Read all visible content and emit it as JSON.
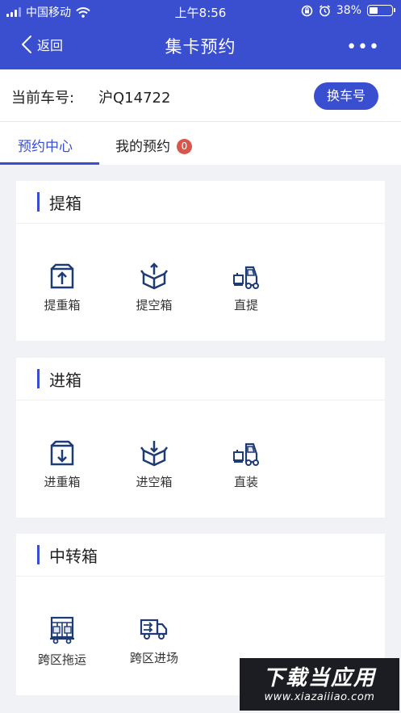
{
  "status_bar": {
    "carrier": "中国移动",
    "time": "上午8:56",
    "battery_percent": "38%",
    "battery_level": 0.38,
    "icons": [
      "signal-icon",
      "wifi-icon",
      "rotation-lock-icon",
      "alarm-icon",
      "battery-icon"
    ]
  },
  "header": {
    "back_label": "返回",
    "title": "集卡预约",
    "more_label": "•••"
  },
  "plate": {
    "label": "当前车号:",
    "value": "沪Q14722",
    "change_button": "换车号"
  },
  "tabs": [
    {
      "label": "预约中心",
      "active": true
    },
    {
      "label": "我的预约",
      "badge": "0",
      "active": false
    }
  ],
  "sections": [
    {
      "title": "提箱",
      "items": [
        {
          "label": "提重箱",
          "icon": "box-up-arrow-icon"
        },
        {
          "label": "提空箱",
          "icon": "open-box-up-arrow-icon"
        },
        {
          "label": "直提",
          "icon": "forklift-icon"
        }
      ]
    },
    {
      "title": "进箱",
      "items": [
        {
          "label": "进重箱",
          "icon": "box-down-arrow-icon"
        },
        {
          "label": "进空箱",
          "icon": "open-box-down-arrow-icon"
        },
        {
          "label": "直装",
          "icon": "forklift-icon"
        }
      ]
    },
    {
      "title": "中转箱",
      "items": [
        {
          "label": "跨区拖运",
          "icon": "container-trailer-icon"
        },
        {
          "label": "跨区进场",
          "icon": "delivery-truck-icon"
        }
      ]
    }
  ],
  "watermark": {
    "line1": "下载当应用",
    "line2": "www.xiazaiiiao.com"
  },
  "colors": {
    "primary": "#3a4fd0",
    "badge": "#d9574a",
    "background": "#f1f2f5",
    "icon_navy": "#1f3b74"
  }
}
